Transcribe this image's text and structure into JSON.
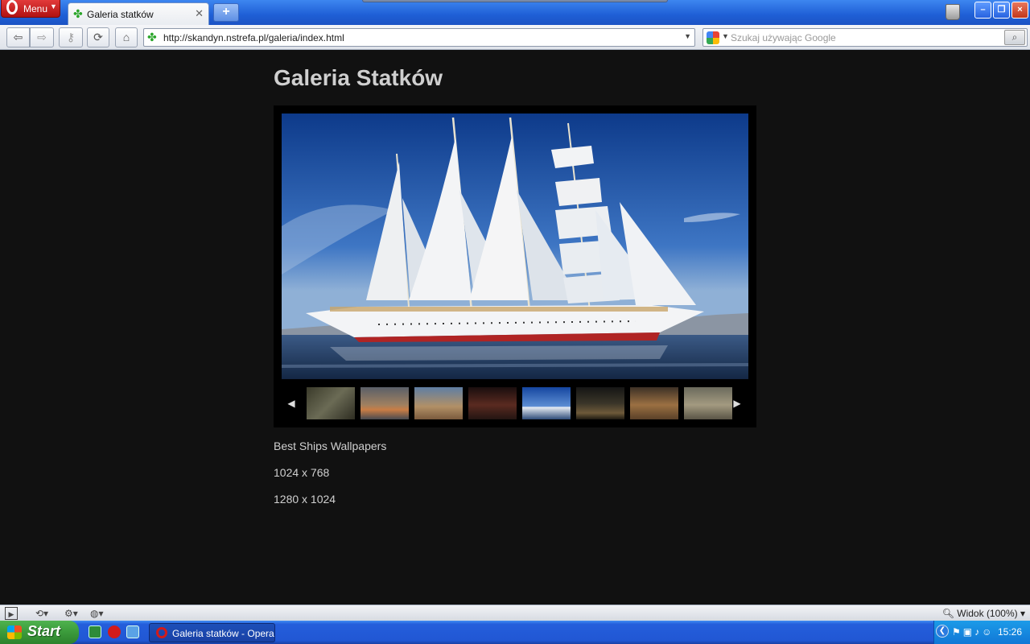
{
  "browser": {
    "menu_label": "Menu",
    "tab_title": "Galeria statków",
    "new_tab_label": "+",
    "address_url": "http://skandyn.nstrefa.pl/galeria/index.html",
    "search_placeholder": "Szukaj używając Google",
    "window_buttons": {
      "minimize": "–",
      "maximize": "❐",
      "close": "×"
    }
  },
  "page": {
    "title": "Galeria Statków",
    "thumbnails": [
      {
        "name": "battle-painting"
      },
      {
        "name": "rowing-boat"
      },
      {
        "name": "galleon-sunset"
      },
      {
        "name": "dark-seascape"
      },
      {
        "name": "white-tall-ship",
        "active": true
      },
      {
        "name": "storm-ship"
      },
      {
        "name": "harbour-sunset"
      },
      {
        "name": "ship-painting"
      }
    ],
    "links": [
      "Best Ships Wallpapers",
      "1024 x 768",
      "1280 x 1024"
    ]
  },
  "statusbar": {
    "zoom_label": "Widok (100%)"
  },
  "taskbar": {
    "start_label": "Start",
    "window_label": "Galeria statków - Opera",
    "clock": "15:26"
  },
  "colors": {
    "page_bg": "#111111",
    "heading": "#cfcfcf",
    "text": "#d0d0d0",
    "tab_bar_blue": "#1f5fd6",
    "opera_red": "#c41a1a",
    "start_green": "#3b9a3b"
  }
}
